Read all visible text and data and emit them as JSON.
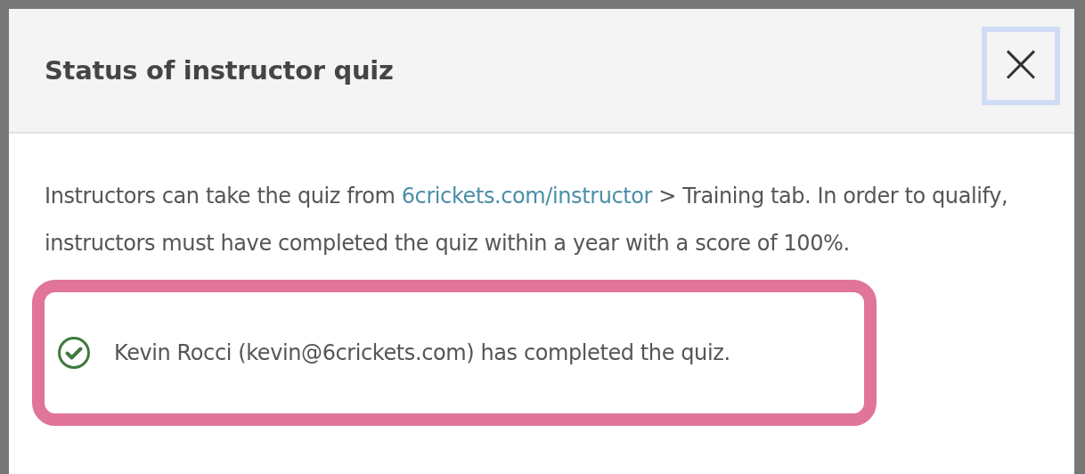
{
  "dialog": {
    "title": "Status of instructor quiz",
    "close_label": "×",
    "intro": {
      "before": "Instructors can take the quiz from ",
      "link": "6crickets.com/instructor",
      "after": " > Training tab. In order to qualify, instructors must have completed the quiz within a year with a score of 100%."
    },
    "status": {
      "kind": "completed",
      "text": "Kevin Rocci (kevin@6crickets.com) has completed the quiz."
    }
  }
}
